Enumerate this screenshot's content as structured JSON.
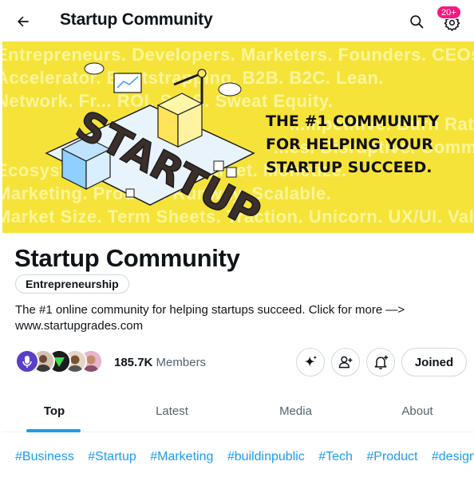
{
  "header": {
    "title": "Startup Community",
    "notification_badge": "20+",
    "icons": [
      "back-arrow-icon",
      "search-icon",
      "settings-gear-icon"
    ]
  },
  "banner": {
    "headline": "THE #1 COMMUNITY FOR HELPING YOUR STARTUP SUCCEED.",
    "art_word": "STARTUP",
    "background_words": [
      "Entrepreneurs. Developers. Marketers. Founders. CEOs.",
      "Accelerator. Bootstrapping. B2B. B2C. Lean.",
      "Network. Fr... ROI. SaaS. Sweat Equity.",
      "...mpetitive. Burn Rate.",
      "...es. Disruptive. Community.",
      "Ecosystem. Leverage. Market. Monetize.",
      "Marketing. Product. Runway. Scalable.",
      "Market Size. Term Sheets. Traction. Unicorn. UX/UI. Value."
    ],
    "colors": {
      "background": "#f6e33a",
      "words": "#fdf59b",
      "headline": "#111111"
    }
  },
  "community": {
    "name": "Startup Community",
    "topic": "Entrepreneurship",
    "description": "The #1 online community for helping startups succeed. Click for more —> www.startupgrades.com",
    "member_count": "185.7K",
    "member_label": "Members",
    "join_button": "Joined",
    "action_icons": [
      "sparkle-icon",
      "add-member-icon",
      "notification-bell-icon"
    ]
  },
  "tabs": [
    {
      "label": "Top",
      "active": true
    },
    {
      "label": "Latest",
      "active": false
    },
    {
      "label": "Media",
      "active": false
    },
    {
      "label": "About",
      "active": false
    }
  ],
  "hashtags": [
    "#Business",
    "#Startup",
    "#Marketing",
    "#buildinpublic",
    "#Tech",
    "#Product",
    "#design"
  ],
  "colors": {
    "accent": "#1d9bf0",
    "badge": "#f91880",
    "text": "#0f1419",
    "secondary_text": "#536471",
    "border": "#cfd9de"
  }
}
